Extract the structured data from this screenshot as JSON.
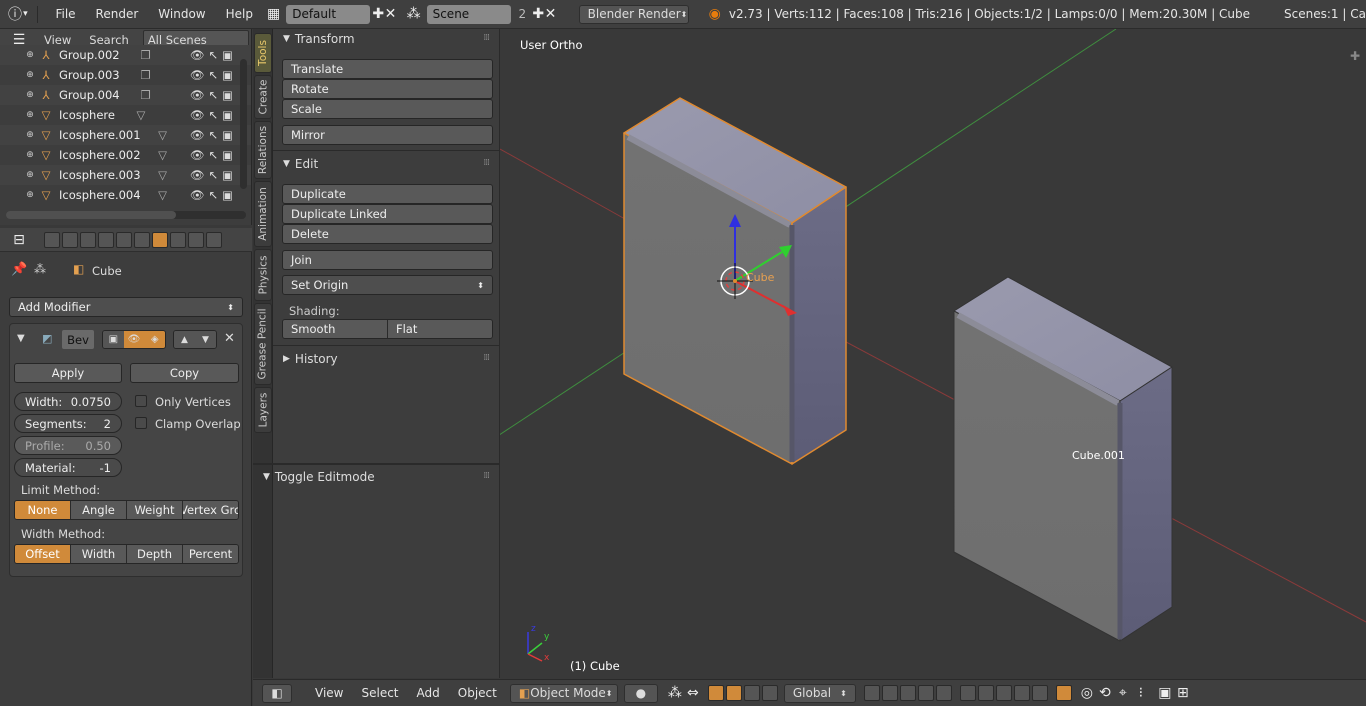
{
  "topbar": {
    "menus": [
      "File",
      "Render",
      "Window",
      "Help"
    ],
    "screen_layout": "Default",
    "scene": "Scene",
    "scene_count": "2",
    "engine": "Blender Render",
    "stats": "v2.73 | Verts:112 | Faces:108 | Tris:216 | Objects:1/2 | Lamps:0/0 | Mem:20.30M | Cube",
    "scenes_label": "Scenes:1 | Ca"
  },
  "outliner": {
    "menus": [
      "View",
      "Search"
    ],
    "filter": "All Scenes",
    "rows": [
      "Group.002",
      "Group.003",
      "Group.004",
      "Icosphere",
      "Icosphere.001",
      "Icosphere.002",
      "Icosphere.003",
      "Icosphere.004"
    ]
  },
  "properties": {
    "object_name": "Cube",
    "add_modifier": "Add Modifier",
    "modifier_name": "Bev",
    "apply": "Apply",
    "copy": "Copy",
    "width_label": "Width:",
    "width_value": "0.0750",
    "segments_label": "Segments:",
    "segments_value": "2",
    "profile_label": "Profile:",
    "profile_value": "0.50",
    "material_label": "Material:",
    "material_value": "-1",
    "only_vertices": "Only Vertices",
    "clamp_overlap": "Clamp Overlap",
    "limit_method_label": "Limit Method:",
    "limit_methods": [
      "None",
      "Angle",
      "Weight",
      "Vertex Gro"
    ],
    "width_method_label": "Width Method:",
    "width_methods": [
      "Offset",
      "Width",
      "Depth",
      "Percent"
    ]
  },
  "vtabs": [
    "Tools",
    "Create",
    "Relations",
    "Animation",
    "Physics",
    "Grease Pencil",
    "Layers"
  ],
  "shelf": {
    "transform": "Transform",
    "translate": "Translate",
    "rotate": "Rotate",
    "scale": "Scale",
    "mirror": "Mirror",
    "edit": "Edit",
    "duplicate": "Duplicate",
    "duplicate_linked": "Duplicate Linked",
    "delete": "Delete",
    "join": "Join",
    "set_origin": "Set Origin",
    "shading": "Shading:",
    "smooth": "Smooth",
    "flat": "Flat",
    "history": "History",
    "toggle_editmode": "Toggle Editmode"
  },
  "viewport": {
    "view_label": "User Ortho",
    "active_label": "Cube",
    "other_label": "Cube.001",
    "status": "(1) Cube",
    "axis_x": "x",
    "axis_y": "y",
    "axis_z": "z"
  },
  "bottom": {
    "menus": [
      "View",
      "Select",
      "Add",
      "Object"
    ],
    "mode": "Object Mode",
    "orientation": "Global"
  },
  "colors": {
    "selection": "#d08a3a",
    "axis_x": "#e03030",
    "axis_y": "#30d030",
    "axis_z": "#3030e0",
    "active_tab": "#e8c86a"
  }
}
